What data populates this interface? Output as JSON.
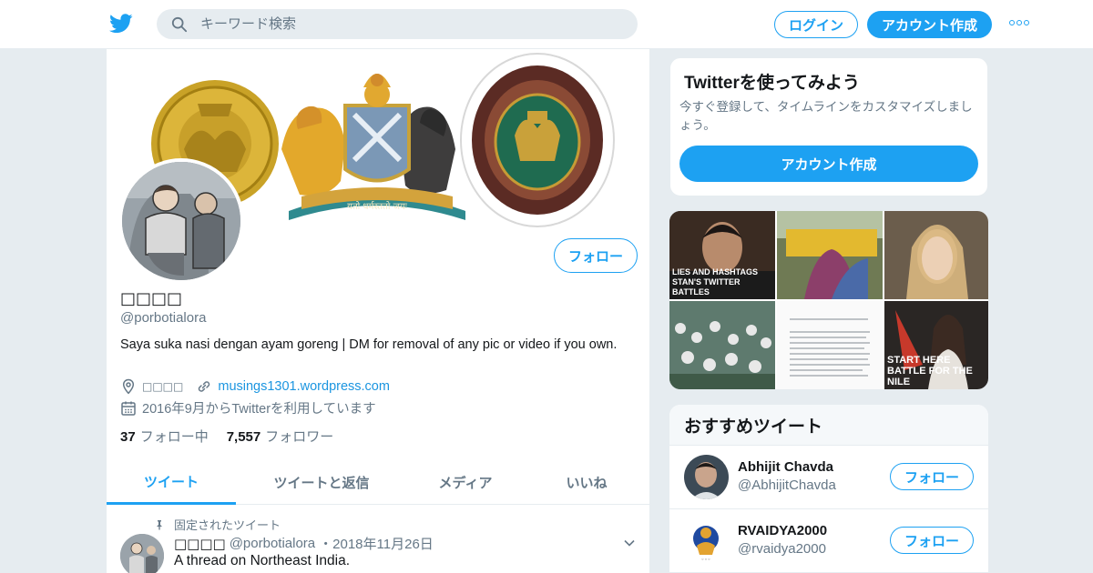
{
  "header": {
    "search_placeholder": "キーワード検索",
    "login_label": "ログイン",
    "signup_label": "アカウント作成",
    "accent_color": "#1da1f2"
  },
  "profile": {
    "display_name": "□□□□",
    "handle": "@porbotialora",
    "bio": "Saya suka nasi dengan ayam goreng | DM for removal of any pic or video if you own.",
    "location": "□□□□",
    "website": "musings1301.wordpress.com",
    "joined": "2016年9月からTwitterを利用しています",
    "following_count": "37",
    "following_label": "フォロー中",
    "followers_count": "7,557",
    "followers_label": "フォロワー",
    "follow_label": "フォロー",
    "banner_motto": "यतो धर्मस्ततो जयः"
  },
  "tabs": [
    {
      "label": "ツイート",
      "active": true
    },
    {
      "label": "ツイートと返信",
      "active": false
    },
    {
      "label": "メディア",
      "active": false
    },
    {
      "label": "いいね",
      "active": false
    }
  ],
  "pinned_tweet": {
    "pinned_label": "固定されたツイート",
    "name": "□□□□",
    "handle": "@porbotialora",
    "date": "・2018年11月26日",
    "text": "A thread on Northeast India."
  },
  "signup_card": {
    "title": "Twitterを使ってみよう",
    "description": "今すぐ登録して、タイムラインをカスタマイズしましょう。",
    "button_label": "アカウント作成"
  },
  "media_grid": {
    "tile1_caption": "LIES AND HASHTAGS STAN'S TWITTER BATTLES",
    "tile6_caption": "START HERE BATTLE FOR THE NILE"
  },
  "recommended": {
    "title": "おすすめツイート",
    "follow_label": "フォロー",
    "accounts": [
      {
        "name": "Abhijit Chavda",
        "handle": "@AbhijitChavda"
      },
      {
        "name": "RVAIDYA2000",
        "handle": "@rvaidya2000"
      }
    ]
  }
}
